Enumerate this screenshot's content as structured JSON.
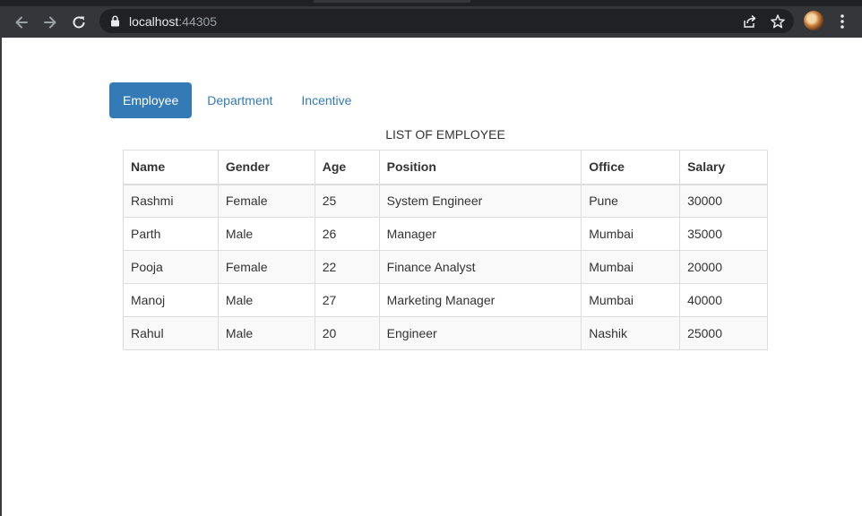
{
  "browser": {
    "url_host": "localhost",
    "url_port": ":44305"
  },
  "nav_tabs": [
    {
      "label": "Employee",
      "active": true
    },
    {
      "label": "Department",
      "active": false
    },
    {
      "label": "Incentive",
      "active": false
    }
  ],
  "table": {
    "caption": "LIST OF EMPLOYEE",
    "headers": [
      "Name",
      "Gender",
      "Age",
      "Position",
      "Office",
      "Salary"
    ],
    "rows": [
      [
        "Rashmi",
        "Female",
        "25",
        "System Engineer",
        "Pune",
        "30000"
      ],
      [
        "Parth",
        "Male",
        "26",
        "Manager",
        "Mumbai",
        "35000"
      ],
      [
        "Pooja",
        "Female",
        "22",
        "Finance Analyst",
        "Mumbai",
        "20000"
      ],
      [
        "Manoj",
        "Male",
        "27",
        "Marketing Manager",
        "Mumbai",
        "40000"
      ],
      [
        "Rahul",
        "Male",
        "20",
        "Engineer",
        "Nashik",
        "25000"
      ]
    ]
  },
  "colors": {
    "accent": "#337ab7",
    "chrome_toolbar": "#35363a",
    "omnibox": "#202124"
  }
}
